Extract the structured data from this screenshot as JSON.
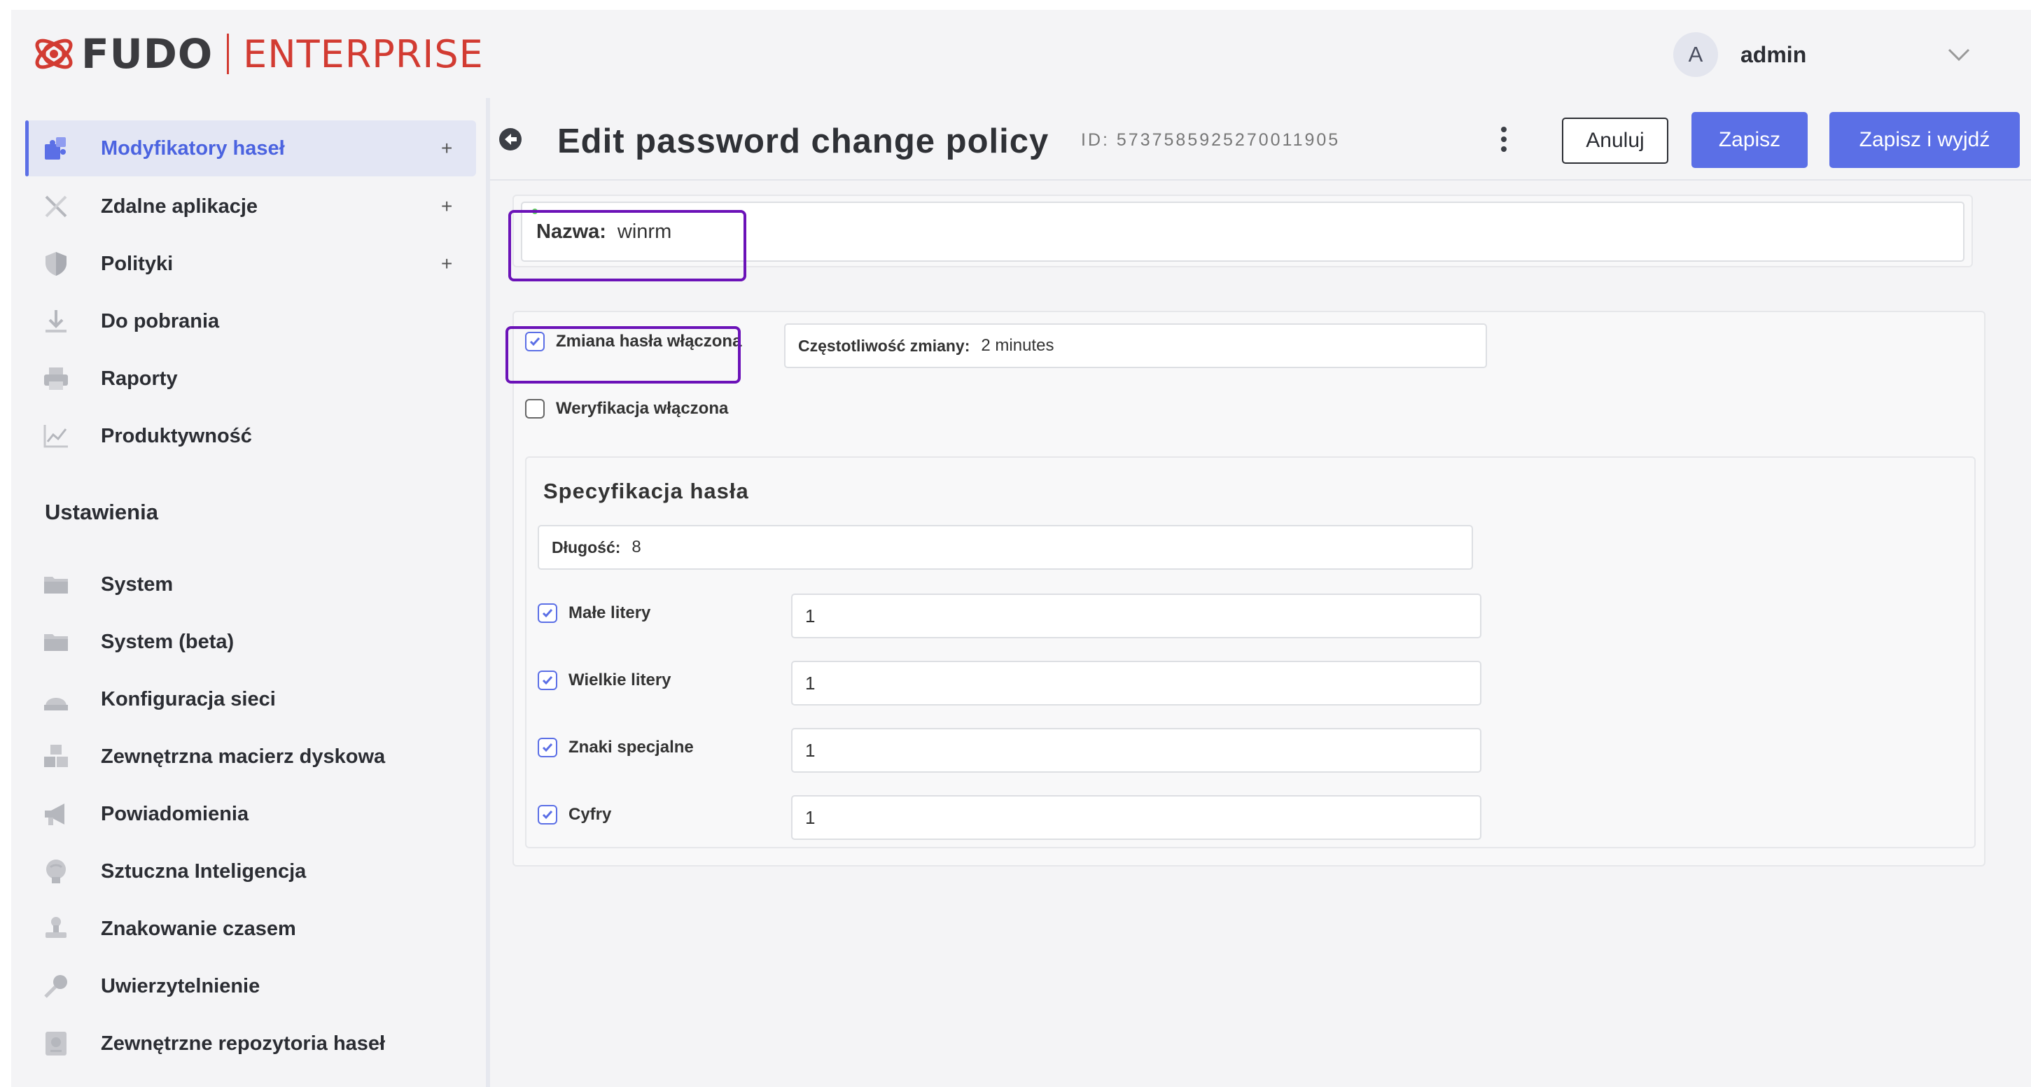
{
  "brand": {
    "name": "FUDO",
    "edition": "ENTERPRISE",
    "accent": "#d23b32"
  },
  "user": {
    "avatar_letter": "A",
    "name": "admin"
  },
  "sidebar": {
    "items": [
      {
        "label": "Modyfikatory haseł",
        "icon": "puzzle-icon",
        "plus": "+",
        "active": true
      },
      {
        "label": "Zdalne aplikacje",
        "icon": "apps-icon",
        "plus": "+"
      },
      {
        "label": "Polityki",
        "icon": "shield-icon",
        "plus": "+"
      },
      {
        "label": "Do pobrania",
        "icon": "download-icon"
      },
      {
        "label": "Raporty",
        "icon": "printer-icon"
      },
      {
        "label": "Produktywność",
        "icon": "chart-icon"
      }
    ],
    "settings_title": "Ustawienia",
    "settings_items": [
      {
        "label": "System",
        "icon": "folder-icon"
      },
      {
        "label": "System (beta)",
        "icon": "folder-icon"
      },
      {
        "label": "Konfiguracja sieci",
        "icon": "network-icon"
      },
      {
        "label": "Zewnętrzna macierz dyskowa",
        "icon": "storage-icon"
      },
      {
        "label": "Powiadomienia",
        "icon": "megaphone-icon"
      },
      {
        "label": "Sztuczna Inteligencja",
        "icon": "brain-icon"
      },
      {
        "label": "Znakowanie czasem",
        "icon": "stamp-icon"
      },
      {
        "label": "Uwierzytelnienie",
        "icon": "key-icon"
      },
      {
        "label": "Zewnętrzne repozytoria haseł",
        "icon": "vault-icon"
      }
    ]
  },
  "header": {
    "title": "Edit password change policy",
    "id_text": "ID: 5737585925270011905",
    "cancel_label": "Anuluj",
    "save_label": "Zapisz",
    "save_exit_label": "Zapisz i wyjdź",
    "accent": "#5b6fe6"
  },
  "form": {
    "name_label": "Nazwa:",
    "name_value": "winrm",
    "change_enabled_label": "Zmiana hasła włączona",
    "change_enabled": true,
    "frequency_label": "Częstotliwość zmiany:",
    "frequency_value": "2 minutes",
    "verification_label": "Weryfikacja włączona",
    "verification_enabled": false,
    "spec": {
      "title": "Specyfikacja hasła",
      "length_label": "Długość:",
      "length_value": "8",
      "rules": [
        {
          "label": "Małe litery",
          "checked": true,
          "value": "1"
        },
        {
          "label": "Wielkie litery",
          "checked": true,
          "value": "1"
        },
        {
          "label": "Znaki specjalne",
          "checked": true,
          "value": "1"
        },
        {
          "label": "Cyfry",
          "checked": true,
          "value": "1"
        }
      ]
    }
  }
}
